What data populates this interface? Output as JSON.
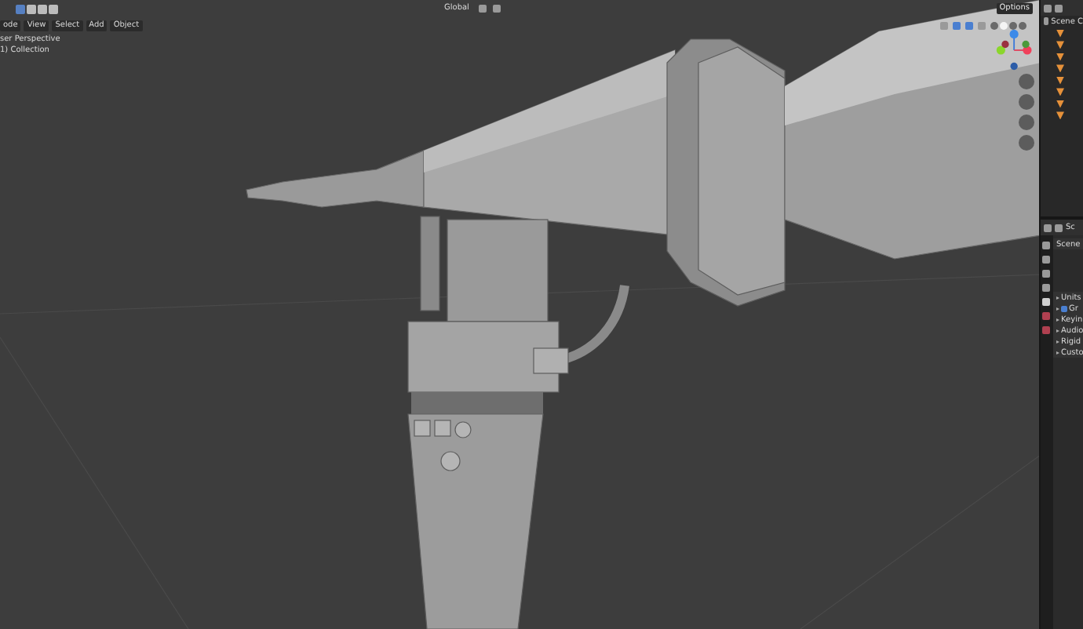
{
  "header": {
    "mode_menu": "ode",
    "menus": [
      "View",
      "Select",
      "Add",
      "Object"
    ],
    "transform_orientation": "Global",
    "options": "Options"
  },
  "viewport": {
    "view_name": "ser Perspective",
    "collection": "1) Collection",
    "shading_modes": [
      {
        "selected": false
      },
      {
        "selected": true
      },
      {
        "selected": false
      },
      {
        "selected": false
      }
    ]
  },
  "outliner": {
    "root": "Scene C"
  },
  "properties": {
    "title": "Sc",
    "scene_row": "Scene",
    "panels": [
      {
        "kind": "plain",
        "label": "Units"
      },
      {
        "kind": "checkbox",
        "label": "Gr",
        "checked": true
      },
      {
        "kind": "plain",
        "label": "Keyin"
      },
      {
        "kind": "plain",
        "label": "Audio"
      },
      {
        "kind": "plain",
        "label": "Rigid"
      },
      {
        "kind": "plain",
        "label": "Custo"
      }
    ]
  }
}
